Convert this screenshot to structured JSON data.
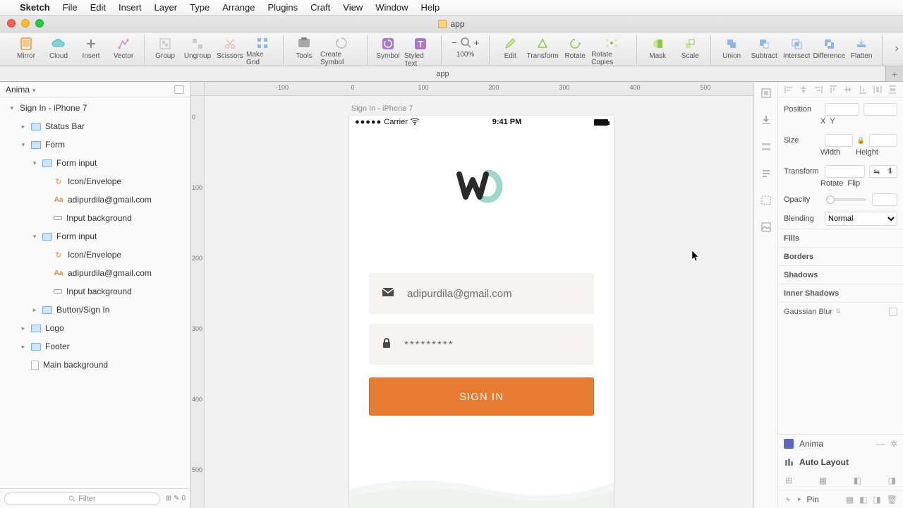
{
  "menubar": {
    "app": "Sketch",
    "items": [
      "File",
      "Edit",
      "Insert",
      "Layer",
      "Type",
      "Arrange",
      "Plugins",
      "Craft",
      "View",
      "Window",
      "Help"
    ]
  },
  "window_title": "app",
  "toolbar": {
    "items": [
      "Mirror",
      "Cloud",
      "Insert",
      "Vector",
      "Group",
      "Ungroup",
      "Scissors",
      "Make Grid",
      "Tools",
      "Create Symbol",
      "Symbol",
      "Styled Text",
      "Edit",
      "Transform",
      "Rotate",
      "Rotate Copies",
      "Mask",
      "Scale",
      "Union",
      "Subtract",
      "Intersect",
      "Difference",
      "Flatten"
    ],
    "zoom": "100%"
  },
  "doc_tab": "app",
  "left": {
    "plugin": "Anima",
    "artboard": "Sign In - iPhone 7",
    "layers": {
      "status_bar": "Status Bar",
      "form": "Form",
      "form_input": "Form input",
      "icon_envelope": "Icon/Envelope",
      "email_text": "adipurdila@gmail.com",
      "input_bg": "Input background",
      "button_signin": "Button/Sign In",
      "logo": "Logo",
      "footer": "Footer",
      "main_bg": "Main background"
    },
    "filter_placeholder": "Filter",
    "counts": "0"
  },
  "ruler": {
    "h": [
      "-100",
      "0",
      "100",
      "200",
      "300",
      "400",
      "500"
    ],
    "v": [
      "0",
      "100",
      "200",
      "300",
      "400",
      "500"
    ]
  },
  "artboard": {
    "label": "Sign In - iPhone 7",
    "status": {
      "carrier": "Carrier",
      "time": "9:41 PM"
    },
    "form": {
      "email": "adipurdila@gmail.com",
      "password": "*********",
      "button": "SIGN IN"
    }
  },
  "inspector": {
    "position": "Position",
    "x": "X",
    "y": "Y",
    "size": "Size",
    "width": "Width",
    "height": "Height",
    "transform": "Transform",
    "rotate": "Rotate",
    "flip": "Flip",
    "opacity": "Opacity",
    "blending": "Blending",
    "blend_value": "Normal",
    "fills": "Fills",
    "borders": "Borders",
    "shadows": "Shadows",
    "inner_shadows": "Inner Shadows",
    "gblur": "Gaussian Blur",
    "anima": "Anima",
    "auto_layout": "Auto Layout",
    "pin": "Pin"
  }
}
